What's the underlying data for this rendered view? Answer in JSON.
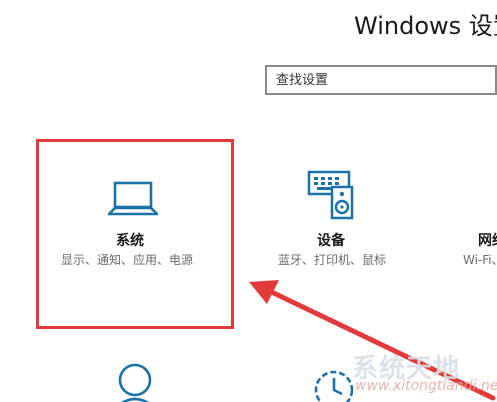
{
  "window": {
    "title": "Windows 设置"
  },
  "search": {
    "placeholder": "查找设置"
  },
  "tiles": [
    {
      "id": "system",
      "title": "系统",
      "desc": "显示、通知、应用、电源",
      "icon": "laptop-icon"
    },
    {
      "id": "devices",
      "title": "设备",
      "desc": "蓝牙、打印机、鼠标",
      "icon": "keyboard-speaker-icon"
    },
    {
      "id": "network",
      "title": "网络",
      "desc": "Wi-Fi、",
      "icon": "network-icon"
    },
    {
      "id": "accounts",
      "title": "",
      "desc": "",
      "icon": "person-icon"
    },
    {
      "id": "time",
      "title": "",
      "desc": "",
      "icon": "clock-icon"
    }
  ],
  "colors": {
    "accent": "#1a73a8",
    "highlight": "#e23a3a"
  },
  "watermark": {
    "brand": "系统天地",
    "url": "www.xitongtiandi.net"
  }
}
